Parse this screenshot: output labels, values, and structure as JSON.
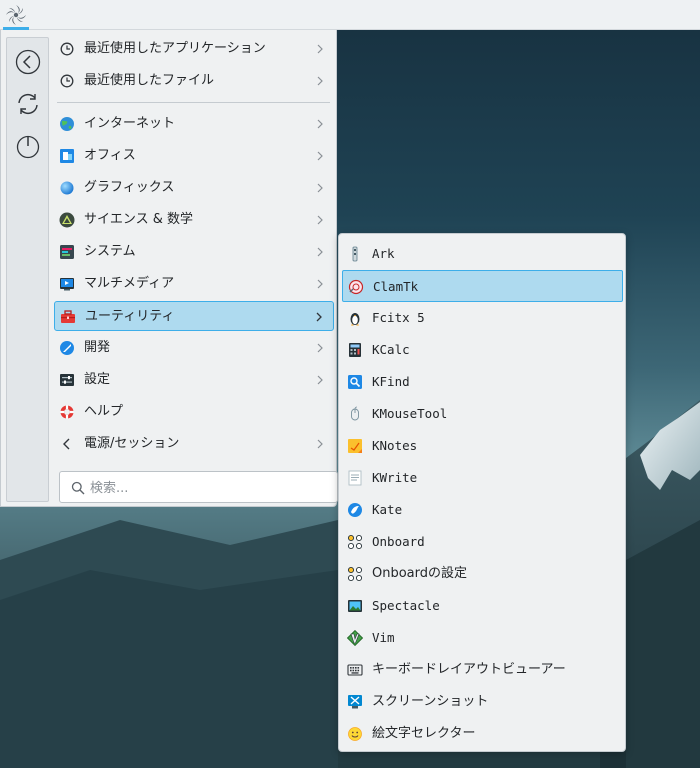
{
  "colors": {
    "accent": "#3daee9",
    "selection_bg": "#aedaef",
    "panel_bg": "#eff1f2",
    "taskbar_bg": "#eef1f3"
  },
  "taskbar": {
    "launcher_icon": "launcher-swirl-icon"
  },
  "sidebar": {
    "buttons": [
      {
        "icon": "back-arrow-icon"
      },
      {
        "icon": "refresh-icon"
      },
      {
        "icon": "power-icon"
      }
    ]
  },
  "menu": {
    "items": [
      {
        "label": "最近使用したアプリケーション",
        "icon": "clock-icon"
      },
      {
        "label": "最近使用したファイル",
        "icon": "clock-icon"
      },
      {
        "label": "インターネット",
        "icon": "globe-icon"
      },
      {
        "label": "オフィス",
        "icon": "office-icon"
      },
      {
        "label": "グラフィックス",
        "icon": "graphics-icon"
      },
      {
        "label": "サイエンス & 数学",
        "icon": "science-icon"
      },
      {
        "label": "システム",
        "icon": "system-icon"
      },
      {
        "label": "マルチメディア",
        "icon": "multimedia-icon"
      },
      {
        "label": "ユーティリティ",
        "icon": "toolbox-icon",
        "selected": true
      },
      {
        "label": "開発",
        "icon": "development-icon"
      },
      {
        "label": "設定",
        "icon": "settings-icon"
      },
      {
        "label": "ヘルプ",
        "icon": "help-lifebuoy-icon"
      },
      {
        "label": "電源/セッション",
        "icon": "back-chevron-icon"
      }
    ]
  },
  "search": {
    "placeholder": "検索...",
    "value": ""
  },
  "submenu": {
    "items": [
      {
        "label": "Ark",
        "icon": "ark-archive-icon"
      },
      {
        "label": "ClamTk",
        "icon": "clamtk-shield-icon",
        "selected": true
      },
      {
        "label": "Fcitx 5",
        "icon": "fcitx-penguin-icon"
      },
      {
        "label": "KCalc",
        "icon": "calculator-icon"
      },
      {
        "label": "KFind",
        "icon": "kfind-magnifier-icon"
      },
      {
        "label": "KMouseTool",
        "icon": "mouse-icon"
      },
      {
        "label": "KNotes",
        "icon": "notes-icon"
      },
      {
        "label": "KWrite",
        "icon": "text-editor-icon"
      },
      {
        "label": "Kate",
        "icon": "kate-bird-icon"
      },
      {
        "label": "Onboard",
        "icon": "keyboard-dots-icon"
      },
      {
        "label": "Onboardの設定",
        "icon": "keyboard-dots-icon"
      },
      {
        "label": "Spectacle",
        "icon": "spectacle-icon"
      },
      {
        "label": "Vim",
        "icon": "vim-icon"
      },
      {
        "label": "キーボードレイアウトビューアー",
        "icon": "keyboard-icon"
      },
      {
        "label": "スクリーンショット",
        "icon": "screenshot-icon"
      },
      {
        "label": "絵文字セレクター",
        "icon": "emoji-icon"
      }
    ]
  }
}
